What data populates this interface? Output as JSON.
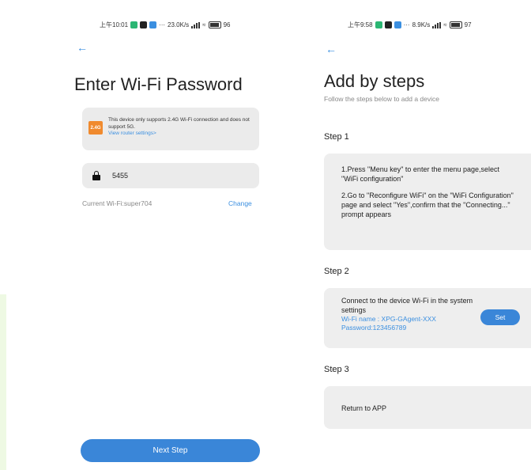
{
  "left_screen": {
    "status_bar": {
      "time": "上午10:01",
      "dots": "···",
      "speed": "23.0K/s",
      "battery": "96"
    },
    "title": "Enter Wi-Fi Password",
    "warning": {
      "badge": "2.4G",
      "text": "This device only supports 2.4G Wi-Fi connection and does not support 5G.",
      "link": "View router settings>"
    },
    "password_value": "5455",
    "current_wifi": "Current Wi-Fi:super704",
    "change_label": "Change",
    "next_button": "Next Step"
  },
  "right_screen": {
    "status_bar": {
      "time": "上午9:58",
      "dots": "···",
      "speed": "8.9K/s",
      "battery": "97"
    },
    "title": "Add by steps",
    "subtitle": "Follow the steps below to add a device",
    "step1": {
      "heading": "Step 1",
      "text_a": "1.Press \"Menu key\" to enter the menu page,select \"WiFi configuration\"",
      "text_b": "2.Go to \"Reconfigure WiFi\" on the \"WiFi Configuration\" page and select \"Yes\",confirm that the \"Connecting...\" prompt appears"
    },
    "step2": {
      "heading": "Step 2",
      "text": "Connect to the device Wi-Fi in the system settings",
      "wifi_name": "Wi-Fi name : XPG-GAgent-XXX",
      "password": "Password:123456789",
      "set_button": "Set"
    },
    "step3": {
      "heading": "Step 3",
      "text": "Return to APP"
    }
  },
  "colors": {
    "accent": "#3a86d8",
    "link": "#3b8fe0",
    "warning_badge": "#f08a2e",
    "card_bg": "#ebebeb"
  }
}
